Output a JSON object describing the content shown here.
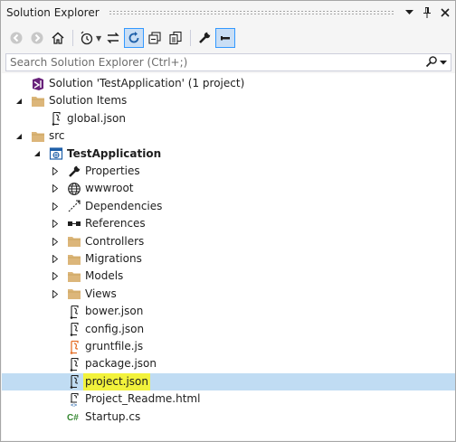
{
  "window": {
    "title": "Solution Explorer",
    "dropdown_glyph": "▼",
    "pin_glyph": "📌",
    "close_glyph": "✕"
  },
  "search": {
    "placeholder": "Search Solution Explorer (Ctrl+;)"
  },
  "colors": {
    "accent": "#3399ff",
    "selection": "#c0dcf3",
    "highlight": "#f2f23c",
    "folder": "#dcb67a",
    "csharp": "#368832",
    "js": "#e5702a"
  },
  "tree": [
    {
      "label": "Solution 'TestApplication' (1 project)",
      "icon": "solution-icon",
      "level": 0,
      "expander": "none"
    },
    {
      "label": "Solution Items",
      "icon": "folder-icon",
      "level": 0,
      "expander": "expanded"
    },
    {
      "label": "global.json",
      "icon": "json-file-icon",
      "level": 1,
      "expander": "none"
    },
    {
      "label": "src",
      "icon": "folder-icon",
      "level": 0,
      "expander": "expanded"
    },
    {
      "label": "TestApplication",
      "icon": "web-project-icon",
      "level": 1,
      "expander": "expanded",
      "bold": true
    },
    {
      "label": "Properties",
      "icon": "wrench-icon",
      "level": 2,
      "expander": "collapsed"
    },
    {
      "label": "wwwroot",
      "icon": "globe-icon",
      "level": 2,
      "expander": "collapsed"
    },
    {
      "label": "Dependencies",
      "icon": "dependencies-icon",
      "level": 2,
      "expander": "collapsed"
    },
    {
      "label": "References",
      "icon": "references-icon",
      "level": 2,
      "expander": "collapsed"
    },
    {
      "label": "Controllers",
      "icon": "folder-icon",
      "level": 2,
      "expander": "collapsed"
    },
    {
      "label": "Migrations",
      "icon": "folder-icon",
      "level": 2,
      "expander": "collapsed"
    },
    {
      "label": "Models",
      "icon": "folder-icon",
      "level": 2,
      "expander": "collapsed"
    },
    {
      "label": "Views",
      "icon": "folder-icon",
      "level": 2,
      "expander": "collapsed"
    },
    {
      "label": "bower.json",
      "icon": "json-file-icon",
      "level": 2,
      "expander": "none"
    },
    {
      "label": "config.json",
      "icon": "json-file-icon",
      "level": 2,
      "expander": "none"
    },
    {
      "label": "gruntfile.js",
      "icon": "js-file-icon",
      "level": 2,
      "expander": "none"
    },
    {
      "label": "package.json",
      "icon": "json-file-icon",
      "level": 2,
      "expander": "none"
    },
    {
      "label": "project.json",
      "icon": "json-file-icon",
      "level": 2,
      "expander": "none",
      "selected": true,
      "highlighted": true
    },
    {
      "label": "Project_Readme.html",
      "icon": "html-file-icon",
      "level": 2,
      "expander": "none"
    },
    {
      "label": "Startup.cs",
      "icon": "csharp-file-icon",
      "level": 2,
      "expander": "none",
      "glyph": "C#"
    }
  ]
}
